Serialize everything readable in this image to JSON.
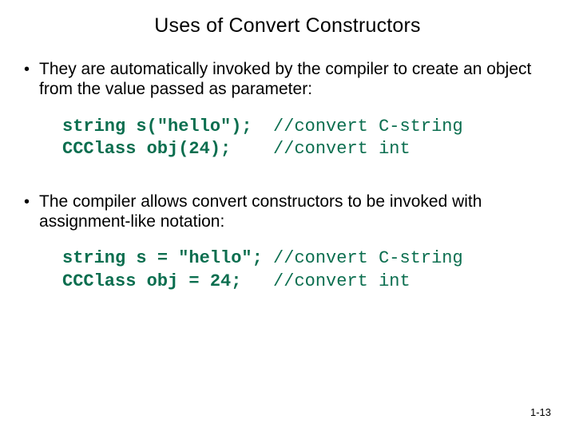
{
  "title": "Uses of Convert Constructors",
  "bullets": [
    "They are automatically invoked by the compiler to create an object from the value passed as parameter:",
    "The compiler allows convert constructors to be invoked with assignment-like notation:"
  ],
  "code_blocks": [
    {
      "lines": [
        {
          "stmt": "string s(\"hello\");  ",
          "comment": "//convert C-string"
        },
        {
          "stmt": "CCClass obj(24);    ",
          "comment": "//convert int"
        }
      ]
    },
    {
      "lines": [
        {
          "stmt": "string s = \"hello\"; ",
          "comment": "//convert C-string"
        },
        {
          "stmt": "CCClass obj = 24;   ",
          "comment": "//convert int"
        }
      ]
    }
  ],
  "page_number": "1-13"
}
